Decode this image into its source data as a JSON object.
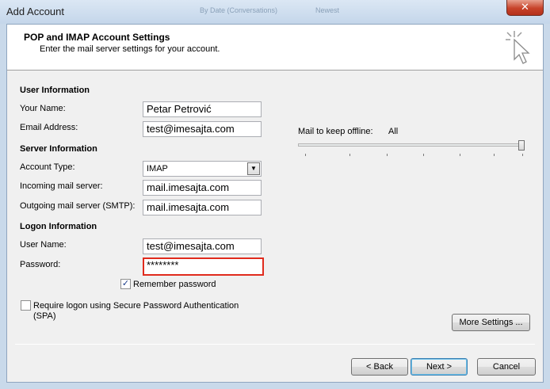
{
  "window": {
    "title": "Add Account",
    "background_text_1": "By Date (Conversations)",
    "background_text_2": "Newest",
    "close_symbol": "✕"
  },
  "header": {
    "title": "POP and IMAP Account Settings",
    "subtitle": "Enter the mail server settings for your account.",
    "icon": "cursor-click-icon"
  },
  "user_info": {
    "section_title": "User Information",
    "your_name_label": "Your Name:",
    "your_name_value": "Petar Petrović",
    "email_label": "Email Address:",
    "email_value": "test@imesajta.com"
  },
  "server_info": {
    "section_title": "Server Information",
    "account_type_label": "Account Type:",
    "account_type_value": "IMAP",
    "incoming_label": "Incoming mail server:",
    "incoming_value": "mail.imesajta.com",
    "outgoing_label": "Outgoing mail server (SMTP):",
    "outgoing_value": "mail.imesajta.com"
  },
  "logon_info": {
    "section_title": "Logon Information",
    "username_label": "User Name:",
    "username_value": "test@imesajta.com",
    "password_label": "Password:",
    "password_value": "********",
    "remember_label": "Remember password",
    "remember_checked": true,
    "spa_label_line1": "Require logon using Secure Password Authentication",
    "spa_label_line2": "(SPA)",
    "spa_checked": false
  },
  "offline": {
    "label": "Mail to keep offline:",
    "value": "All",
    "slider_level": 1.0
  },
  "buttons": {
    "more_settings": "More Settings ...",
    "back": "< Back",
    "next": "Next >",
    "cancel": "Cancel"
  },
  "colors": {
    "focus_outline": "#e02b1d",
    "close_button": "#c7432a"
  }
}
